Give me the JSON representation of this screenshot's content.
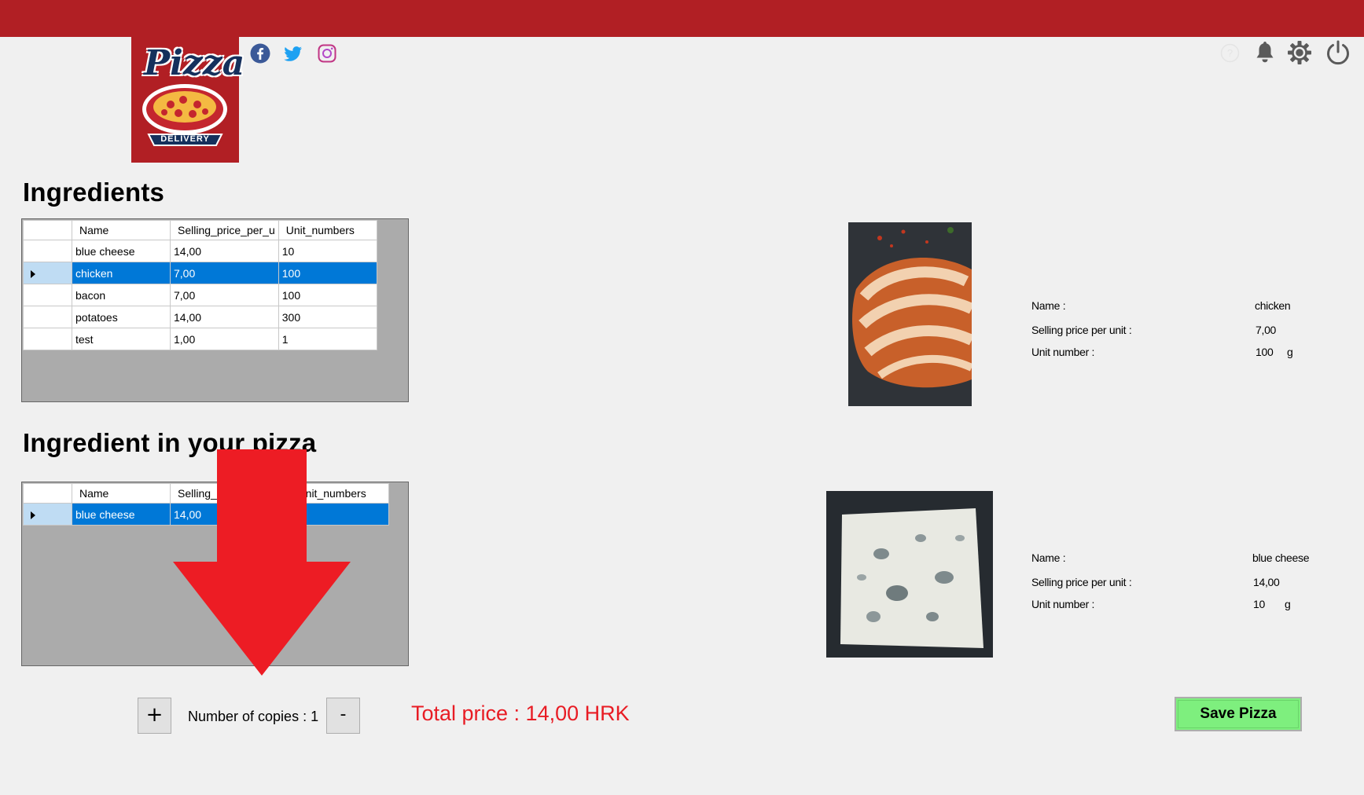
{
  "header": {
    "brand_title": "Pizza",
    "brand_subtitle": "DELIVERY",
    "social_icons": [
      "facebook-icon",
      "twitter-icon",
      "instagram-icon"
    ],
    "top_icons": [
      "help-icon",
      "bell-icon",
      "gear-icon",
      "power-icon"
    ],
    "colors": {
      "topbar": "#b11f24",
      "facebook": "#3b5998",
      "twitter": "#1da1f2",
      "instagram": "#c13584"
    }
  },
  "ingredients": {
    "title": "Ingredients",
    "columns": [
      "Name",
      "Selling_price_per_u",
      "Unit_numbers"
    ],
    "rows": [
      {
        "name": "blue cheese",
        "price": "14,00",
        "units": "10"
      },
      {
        "name": "chicken",
        "price": "7,00",
        "units": "100"
      },
      {
        "name": "bacon",
        "price": "7,00",
        "units": "100"
      },
      {
        "name": "potatoes",
        "price": "14,00",
        "units": "300"
      },
      {
        "name": "test",
        "price": "1,00",
        "units": "1"
      }
    ],
    "selected_index": 1
  },
  "pizza_ingredients": {
    "title": "Ingredient in your pizza",
    "columns": [
      "Name",
      "Selling_price_per_unit",
      "Unit_numbers"
    ],
    "rows": [
      {
        "name": "blue cheese",
        "price": "14,00",
        "units": ""
      }
    ],
    "selected_index": 0
  },
  "detail_selected": {
    "name_label": "Name :",
    "price_label": "Selling price per unit :",
    "unit_label": "Unit number :",
    "name": "chicken",
    "price": "7,00",
    "unit": "100",
    "unit_suffix": "g"
  },
  "detail_pizza": {
    "name_label": "Name :",
    "price_label": "Selling price per unit :",
    "unit_label": "Unit number :",
    "name": "blue cheese",
    "price": "14,00",
    "unit": "10",
    "unit_suffix": "g"
  },
  "footer": {
    "plus_label": "+",
    "copies_label": "Number of copies : 1",
    "minus_label": "-",
    "total_price": "Total price : 14,00 HRK",
    "save_label": "Save Pizza",
    "colors": {
      "total": "#e81c24",
      "save": "#7eef7e"
    }
  },
  "overlay": {
    "arrow_color": "#ed1c24"
  }
}
